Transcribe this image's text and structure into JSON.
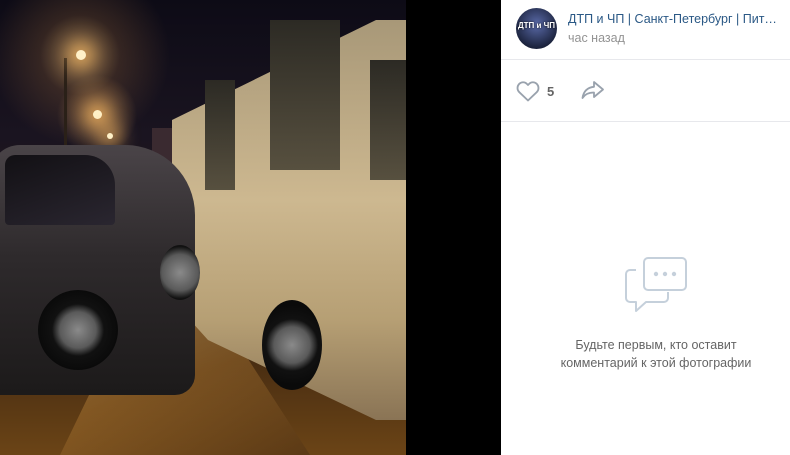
{
  "photo": {
    "description_icon": "photo-accident-scene"
  },
  "post": {
    "avatar_label_top": "ДТП и ЧП",
    "avatar_label_bottom": "",
    "group_name": "ДТП и ЧП | Санкт-Петербург | Питер Онлайн | СПб",
    "time": "час назад"
  },
  "actions": {
    "like_icon": "heart-icon",
    "like_count": "5",
    "share_icon": "share-arrow-icon"
  },
  "comments": {
    "empty_icon": "comments-bubble-icon",
    "empty_line1": "Будьте первым, кто оставит",
    "empty_line2": "комментарий к этой фотографии"
  },
  "colors": {
    "link": "#2a5885",
    "muted": "#939393",
    "icon": "#99a2ad",
    "divider": "#e7e8ec"
  }
}
